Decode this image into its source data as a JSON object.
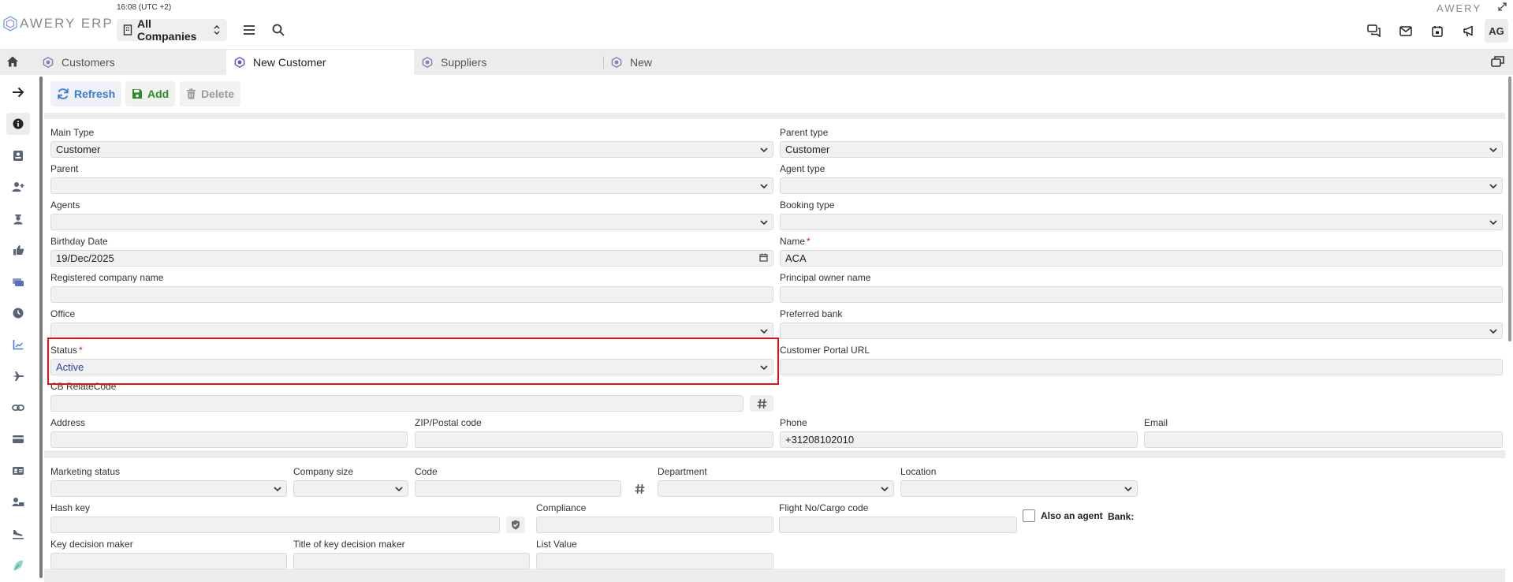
{
  "header": {
    "logo_text": "AWERY ERP",
    "clock": "16:08 (UTC +2)",
    "company": "All Companies",
    "brand_right": "AWERY",
    "avatar": "AG",
    "icons": [
      "chat-icon",
      "mail-icon",
      "calendar-icon",
      "megaphone-icon"
    ]
  },
  "tabs": [
    {
      "label": "Customers"
    },
    {
      "label": "New Customer",
      "active": true
    },
    {
      "label": "Suppliers"
    },
    {
      "label": "New"
    }
  ],
  "sidebar": {
    "items": [
      "arrow-right-icon",
      "info-icon",
      "contact-card-icon",
      "add-user-icon",
      "agent-icon",
      "thumbs-up-icon",
      "payment-icon",
      "clock-icon",
      "chart-icon",
      "plane-icon",
      "link-icon",
      "card-icon",
      "id-card-icon",
      "users-chat-icon",
      "plane-landing-icon",
      "leaf-icon"
    ]
  },
  "toolbar": {
    "refresh_label": "Refresh",
    "add_label": "Add",
    "delete_label": "Delete"
  },
  "form": {
    "main_type": {
      "label": "Main Type",
      "value": "Customer"
    },
    "parent_type": {
      "label": "Parent type",
      "value": "Customer"
    },
    "parent": {
      "label": "Parent",
      "value": ""
    },
    "agent_type": {
      "label": "Agent type",
      "value": ""
    },
    "agents": {
      "label": "Agents",
      "value": ""
    },
    "booking_type": {
      "label": "Booking type",
      "value": ""
    },
    "birthday_date": {
      "label": "Birthday Date",
      "value": "19/Dec/2025"
    },
    "name": {
      "label": "Name",
      "value": "ACA",
      "required": "*"
    },
    "registered_company_name": {
      "label": "Registered company name",
      "value": ""
    },
    "principal_owner_name": {
      "label": "Principal owner name",
      "value": ""
    },
    "office": {
      "label": "Office",
      "value": ""
    },
    "preferred_bank": {
      "label": "Preferred bank",
      "value": ""
    },
    "status": {
      "label": "Status",
      "value": "Active",
      "required": "*"
    },
    "customer_portal_url": {
      "label": "Customer Portal URL",
      "value": ""
    },
    "cb_relate_code": {
      "label": "CB RelateCode",
      "value": ""
    },
    "address": {
      "label": "Address",
      "value": ""
    },
    "zip": {
      "label": "ZIP/Postal code",
      "value": ""
    },
    "phone": {
      "label": "Phone",
      "value": "+31208102010"
    },
    "email": {
      "label": "Email",
      "value": ""
    }
  },
  "form2": {
    "marketing_status": {
      "label": "Marketing status",
      "value": ""
    },
    "company_size": {
      "label": "Company size",
      "value": ""
    },
    "code": {
      "label": "Code",
      "value": ""
    },
    "department": {
      "label": "Department",
      "value": ""
    },
    "location": {
      "label": "Location",
      "value": ""
    },
    "hash_key": {
      "label": "Hash key",
      "value": ""
    },
    "compliance": {
      "label": "Compliance",
      "value": ""
    },
    "flight_no": {
      "label": "Flight No/Cargo code",
      "value": ""
    },
    "also_agent": {
      "label": "Also an agent",
      "checked": false
    },
    "bank": {
      "label": "Bank:"
    },
    "key_decision_maker": {
      "label": "Key decision maker",
      "value": ""
    },
    "title_key_decision_maker": {
      "label": "Title of key decision maker",
      "value": ""
    },
    "list_value": {
      "label": "List Value",
      "value": ""
    }
  },
  "colors": {
    "accent": "#3a7bd5",
    "add_green": "#2e8b2e",
    "required_red": "#d01818",
    "highlight": "#e01414",
    "tab_hex_purple": "#6a4fc2"
  }
}
